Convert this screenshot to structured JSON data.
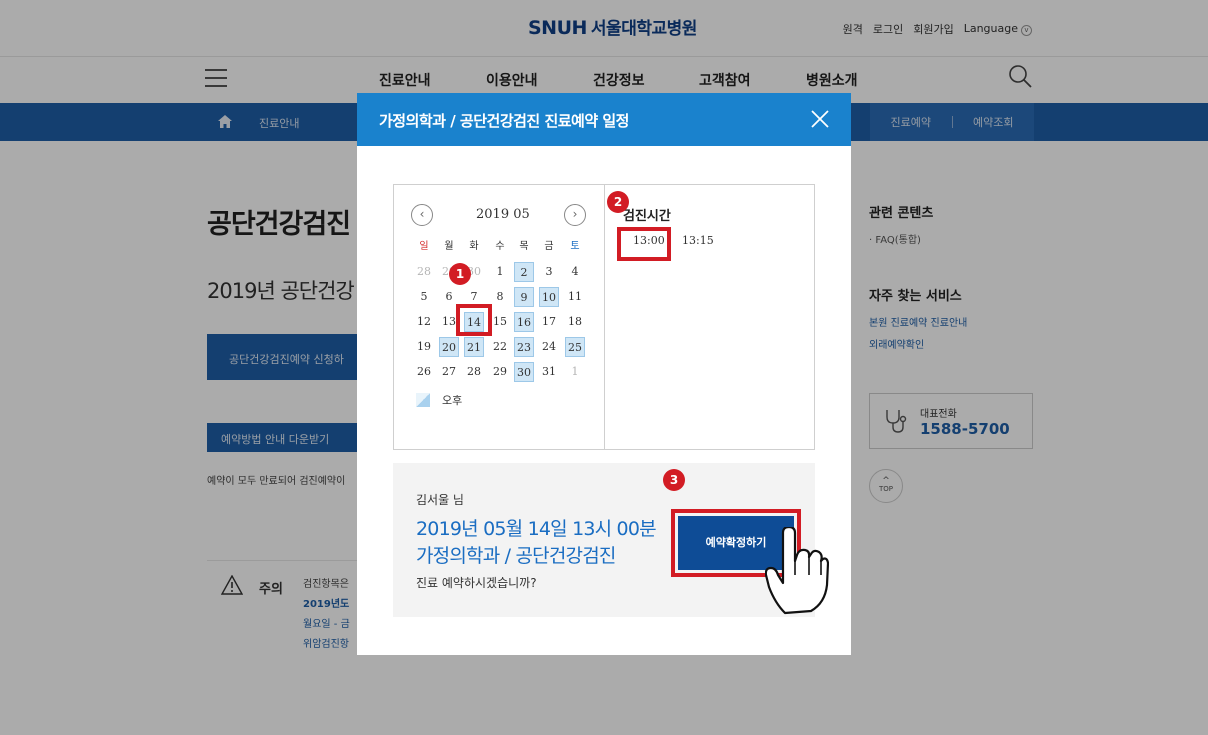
{
  "header": {
    "logo_text": "SNUH",
    "logo_korean": "서울대학교병원",
    "util_links": [
      "원격",
      "로그인",
      "회원가입",
      "Language"
    ]
  },
  "gnb": {
    "menu": [
      "진료안내",
      "이용안내",
      "건강정보",
      "고객참여",
      "병원소개"
    ]
  },
  "bluebar": {
    "breadcrumb": "진료안내",
    "tabs": [
      "진료예약",
      "예약조회"
    ]
  },
  "page": {
    "title": "공단건강검진",
    "subtitle": "2019년 공단건강",
    "apply_button": "공단건강검진예약 신청하",
    "download_button": "예약방법 안내 다운받기",
    "note": "예약이 모두 만료되어 검진예약이",
    "caution_label": "주의",
    "caution_lines": [
      "검진항목은",
      "2019년도",
      "월요일 - 금",
      "위암검진항"
    ]
  },
  "sidebar": {
    "related_title": "관련 콘텐츠",
    "related_link": "· FAQ(통합)",
    "services_title": "자주 찾는 서비스",
    "service_links": [
      "본원 진료예약 진료안내",
      "외래예약확인"
    ],
    "phone_label": "대표전화",
    "phone_number": "1588-5700",
    "top_label": "TOP"
  },
  "modal": {
    "title": "가정의학과 / 공단건강검진 진료예약 일정",
    "calendar": {
      "month_label": "2019 05",
      "weekdays": [
        "일",
        "월",
        "화",
        "수",
        "목",
        "금",
        "토"
      ],
      "weeks": [
        [
          "28",
          "29",
          "30",
          "1",
          "2",
          "3",
          "4"
        ],
        [
          "5",
          "6",
          "7",
          "8",
          "9",
          "10",
          "11"
        ],
        [
          "12",
          "13",
          "14",
          "15",
          "16",
          "17",
          "18"
        ],
        [
          "19",
          "20",
          "21",
          "22",
          "23",
          "24",
          "25"
        ],
        [
          "26",
          "27",
          "28",
          "29",
          "30",
          "31",
          "1"
        ]
      ],
      "available_days": [
        "2",
        "9",
        "10",
        "14",
        "16",
        "20",
        "21",
        "23",
        "25",
        "30"
      ],
      "selected_day": "14",
      "legend_label": "오후"
    },
    "time_title": "검진시간",
    "time_slots": [
      "13:00",
      "13:15"
    ],
    "selected_time": "13:00",
    "confirm": {
      "user": "김서울 님",
      "date_text": "2019년 05월 14일 13시 00분",
      "dept_text": "가정의학과 / 공단건강검진",
      "question": "진료 예약하시겠습니까?",
      "button_label": "예약확정하기"
    }
  },
  "annotations": {
    "step1": "1",
    "step2": "2",
    "step3": "3"
  },
  "colors": {
    "brand_blue": "#1a82cd",
    "navy": "#0e4c96",
    "highlight_red": "#d21c24"
  }
}
